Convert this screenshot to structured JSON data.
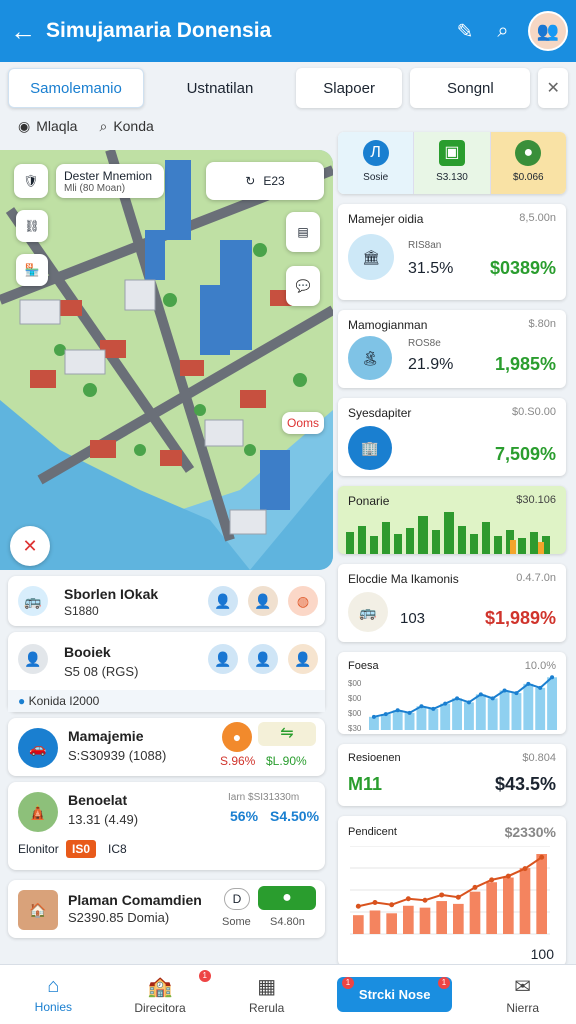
{
  "appbar": {
    "title": "Simujamaria Donensia",
    "back_icon": "arrow-left-icon",
    "icons": [
      "edit-icon",
      "search-icon"
    ]
  },
  "tabs": [
    "Samolemanio",
    "Ustnatilan",
    "Slapoer",
    "Songnl"
  ],
  "filters": [
    "Mlaqla",
    "Konda"
  ],
  "map": {
    "badge": "Dester Mnemion",
    "badge_sub": "Mli (80 Moan)",
    "chip_value": "E23",
    "pin_label": "Ooms"
  },
  "left_cards": [
    {
      "title": "Sborlen IOkak",
      "sub": "S1880"
    },
    {
      "title": "Booiek",
      "sub": "S5 08 (RGS)",
      "note": "Konida I2000"
    },
    {
      "title": "Mamajemie",
      "sub": "S:S30939 (1088)",
      "v1": "S.96%",
      "v2": "$L.90%"
    },
    {
      "title": "Benoelat",
      "sub": "13.31 (4.49)",
      "meta": "Iarn $SI31330m",
      "v1": "56%",
      "v2": "S4.50%",
      "tag_label": "Elonitor",
      "tag": "IS0",
      "tag_after": "IC8"
    },
    {
      "title": "Plaman Comamdien",
      "sub": "S2390.85 Domia)",
      "pill1": "Some",
      "pill2": "S4.80n"
    }
  ],
  "summary": [
    {
      "label": "Sosie",
      "color": "#1a7fd0"
    },
    {
      "label": "S3.130",
      "color": "#2a9d2e"
    },
    {
      "label": "$0.066",
      "color": "#f2a623"
    }
  ],
  "right_cards": [
    {
      "title": "Mamejer oidia",
      "top": "8,5.00n",
      "sub": "RIS8an",
      "big": "31.5%",
      "accent": "$0389%"
    },
    {
      "title": "Mamogianman",
      "top": "$.80n",
      "sub": "ROS8e",
      "big": "21.9%",
      "accent": "1,985%"
    },
    {
      "title": "Syesdapiter",
      "top": "$0.S0.00",
      "accent": "7,509%"
    },
    {
      "title": "Ponarie",
      "top": "$30.106"
    },
    {
      "title": "Elocdie Ma Ikamonis",
      "top": "0.4.7.0n",
      "big": "103",
      "accent": "$1,989%"
    },
    {
      "title": "Foesa",
      "top": "10.0%",
      "ticks": [
        "$00",
        "$00",
        "$00",
        "$30"
      ]
    },
    {
      "title": "Resioenen",
      "top": "$0.804",
      "big": "M11",
      "accent": "$43.5%"
    },
    {
      "title": "Pendicent",
      "top": "$2330%",
      "footer": "100"
    }
  ],
  "chart_blue": {
    "type": "area",
    "values": [
      10,
      12,
      15,
      13,
      18,
      16,
      20,
      24,
      21,
      27,
      24,
      30,
      28,
      35,
      32,
      40
    ]
  },
  "chart_orange": {
    "type": "bar",
    "values": [
      20,
      25,
      22,
      30,
      28,
      35,
      32,
      45,
      55,
      60,
      70,
      85
    ]
  },
  "bottom_nav": [
    {
      "label": "Honies",
      "icon": "home-icon"
    },
    {
      "label": "Direcitora",
      "icon": "school-icon"
    },
    {
      "label": "Rerula",
      "icon": "calendar-icon"
    },
    {
      "label": "Strcki Nose",
      "icon": "button"
    },
    {
      "label": "Nierra",
      "icon": "mail-icon"
    }
  ]
}
